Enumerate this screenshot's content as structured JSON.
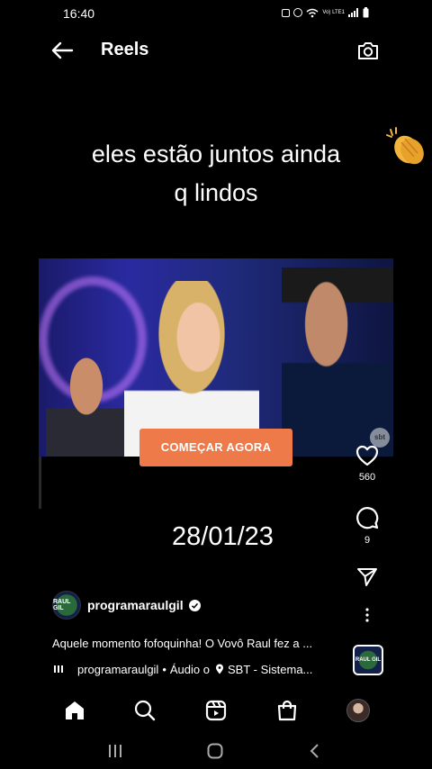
{
  "status_bar": {
    "time": "16:40",
    "lte_label": "Vo) LTE1"
  },
  "header": {
    "title": "Reels"
  },
  "video": {
    "overlay_line1": "eles estão juntos ainda",
    "overlay_line2": "q lindos",
    "clap_emoji": "clapping-hands",
    "broadcaster_badge": "sbt",
    "date_text": "28/01/23"
  },
  "cta": {
    "label": "COMEÇAR AGORA",
    "color": "#ee7a4a"
  },
  "actions": {
    "likes": "560",
    "comments": "9"
  },
  "post": {
    "author": "programaraulgil",
    "author_avatar_text": "RAUL GIL",
    "caption": "Aquele momento fofoquinha! O Vovô Raul fez a ...",
    "audio_author": "programaraulgil",
    "audio_label": "Áudio o",
    "location": "SBT - Sistema...",
    "separator": "•"
  },
  "bottom_nav": {
    "items": [
      "home-icon",
      "search-icon",
      "reels-icon",
      "shop-icon",
      "profile-avatar"
    ]
  }
}
